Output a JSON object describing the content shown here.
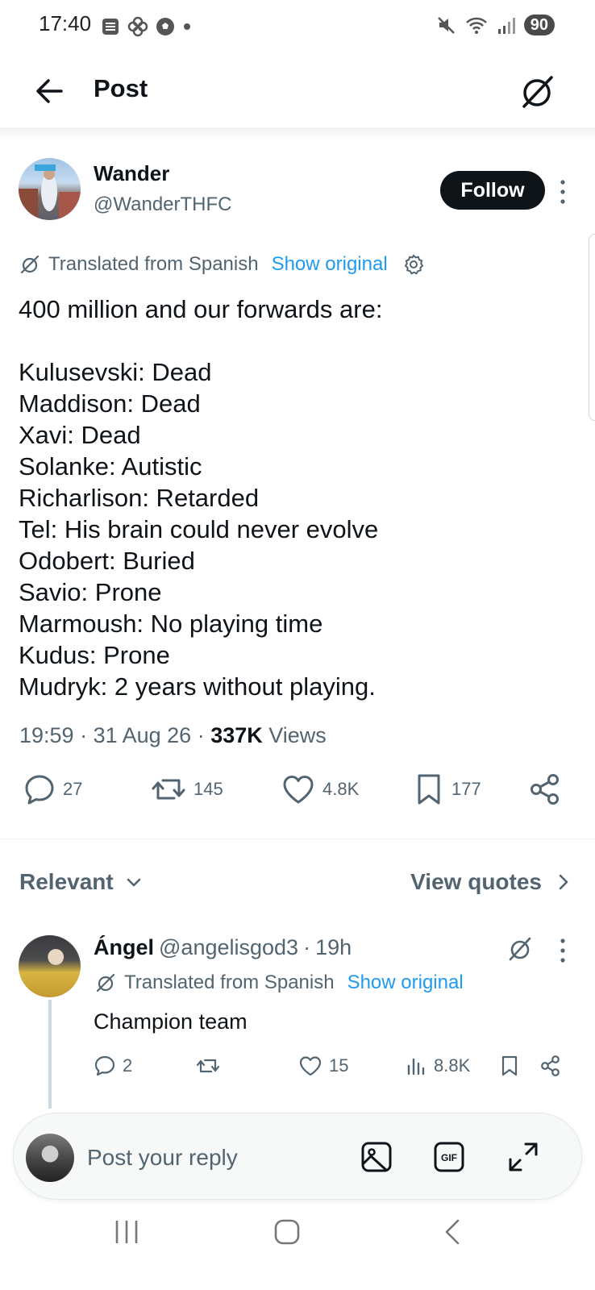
{
  "status_bar": {
    "time": "17:40",
    "battery": "90"
  },
  "header": {
    "title": "Post"
  },
  "post": {
    "author_name": "Wander",
    "author_handle": "@WanderTHFC",
    "follow_label": "Follow",
    "translated_label": "Translated from Spanish",
    "show_original_label": "Show original",
    "body": "400 million and our forwards are:\n\nKulusevski: Dead\nMaddison: Dead\nXavi: Dead\nSolanke: Autistic\nRicharlison: Retarded\nTel: His brain could never evolve\nOdobert: Buried\nSavio: Prone\nMarmoush: No playing time\nKudus: Prone\nMudryk: 2 years without playing.",
    "time": "19:59",
    "date": "31 Aug 26",
    "views_count": "337K",
    "views_label": "Views",
    "replies": "27",
    "reposts": "145",
    "likes": "4.8K",
    "bookmarks": "177"
  },
  "replies_section": {
    "sort_label": "Relevant",
    "view_quotes_label": "View quotes"
  },
  "reply": {
    "name": "Ángel",
    "handle": "@angelisgod3",
    "age": "19h",
    "translated_label": "Translated from Spanish",
    "show_original_label": "Show original",
    "text": "Champion team",
    "replies": "2",
    "likes": "15",
    "views": "8.8K"
  },
  "composer": {
    "placeholder": "Post your reply"
  },
  "colors": {
    "accent": "#1d9bf0",
    "text": "#0f1419",
    "secondary": "#536471"
  }
}
